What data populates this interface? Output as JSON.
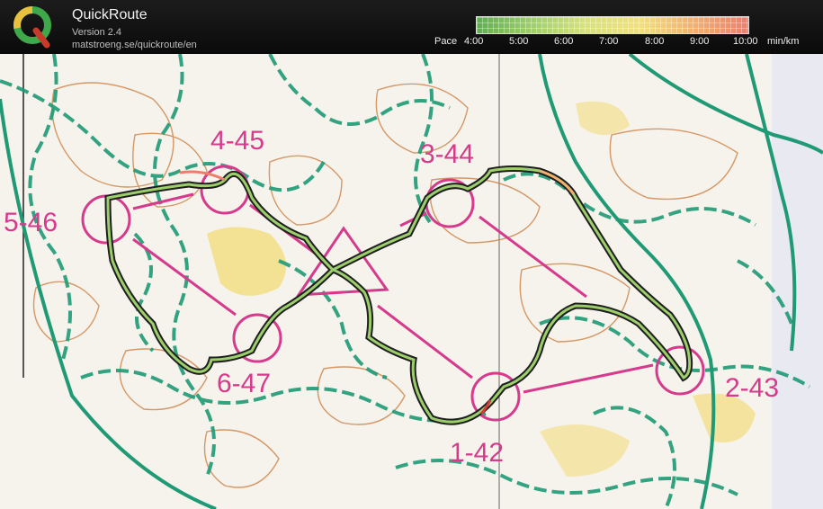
{
  "app": {
    "title": "QuickRoute",
    "version": "Version 2.4",
    "url": "matstroeng.se/quickroute/en"
  },
  "pace_legend": {
    "label": "Pace",
    "ticks": [
      "4:00",
      "5:00",
      "6:00",
      "7:00",
      "8:00",
      "9:00",
      "10:00"
    ],
    "unit": "min/km",
    "colors": [
      "#5fae50",
      "#9ccf6b",
      "#d7e27a",
      "#f3e07a",
      "#f2b070",
      "#ee7d6c"
    ]
  },
  "map": {
    "background_color": "#f4f1ea",
    "path_color": "#1f9a75",
    "contour_color": "#c9793a",
    "course_color": "#d63a8c",
    "route_color": "#1f1f1f",
    "controls": [
      {
        "label": "1-42"
      },
      {
        "label": "2-43"
      },
      {
        "label": "3-44"
      },
      {
        "label": "4-45"
      },
      {
        "label": "5-46"
      },
      {
        "label": "6-47"
      }
    ]
  }
}
